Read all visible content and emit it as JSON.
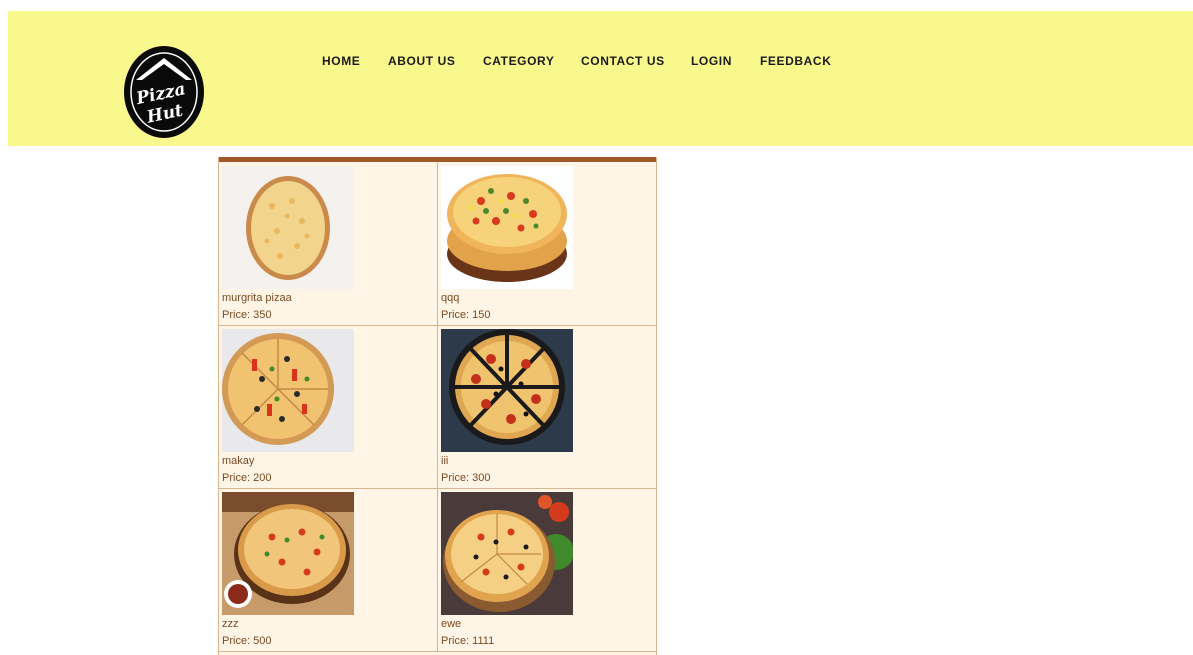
{
  "brand": {
    "logo_text_line1": "Pizza",
    "logo_text_line2": "Hut"
  },
  "nav": {
    "items": [
      {
        "label": "HOME"
      },
      {
        "label": "ABOUT US"
      },
      {
        "label": "CATEGORY"
      },
      {
        "label": "CONTACT US"
      },
      {
        "label": "LOGIN"
      },
      {
        "label": "FEEDBACK"
      }
    ]
  },
  "products": [
    {
      "name": "murgrita pizaa",
      "price": "Price: 350",
      "image": "cheese-pizza-image"
    },
    {
      "name": "qqq",
      "price": "Price: 150",
      "image": "veggie-pan-pizza-image"
    },
    {
      "name": "makay",
      "price": "Price: 200",
      "image": "sliced-veggie-pizza-image"
    },
    {
      "name": "iii",
      "price": "Price: 300",
      "image": "pepperoni-olive-pizza-image"
    },
    {
      "name": "zzz",
      "price": "Price: 500",
      "image": "pizza-with-sauce-image"
    },
    {
      "name": "ewe",
      "price": "Price: 1111",
      "image": "pizza-with-vegetables-image"
    }
  ],
  "colors": {
    "header_bg": "#f8f88c",
    "catalog_bg": "#fff5e6",
    "accent_bar": "#a05a2a",
    "text_brown": "#7a4a22"
  }
}
